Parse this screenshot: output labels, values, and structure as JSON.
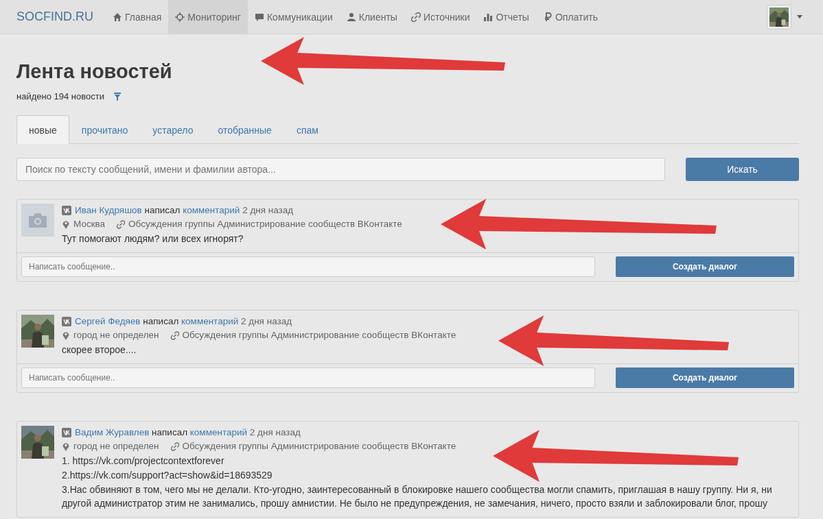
{
  "navbar": {
    "brand": "SOCFIND.RU",
    "items": [
      {
        "label": "Главная",
        "selected": false
      },
      {
        "label": "Мониторинг",
        "selected": true
      },
      {
        "label": "Коммуникации",
        "selected": false
      },
      {
        "label": "Клиенты",
        "selected": false
      },
      {
        "label": "Источники",
        "selected": false
      },
      {
        "label": "Отчеты",
        "selected": false
      },
      {
        "label": "Оплатить",
        "selected": false
      }
    ],
    "user_avatar": {
      "kind": "picture"
    }
  },
  "page": {
    "title": "Лента новостей",
    "found": "найдено 194 новости"
  },
  "tabs": [
    {
      "label": "новые",
      "selected": true
    },
    {
      "label": "прочитано",
      "selected": false
    },
    {
      "label": "устарело",
      "selected": false
    },
    {
      "label": "отобранные",
      "selected": false
    },
    {
      "label": "спам",
      "selected": false
    }
  ],
  "search": {
    "placeholder": "Поиск по тексту сообщений, имени и фамилии автора...",
    "button": "Искать"
  },
  "posts": [
    {
      "avatar": {
        "kind": "placeholder"
      },
      "author": "Иван Кудряшов",
      "action": "написал",
      "link": "комментарий",
      "time": "2 дня назад",
      "location": "Москва",
      "source": "Обсуждения группы Администрирование сообществ ВКонтакте",
      "lines": [
        "Тут помогают людям? или всех игнорят?"
      ],
      "reply_placeholder": "Написать сообщение..",
      "reply_button": "Создать диалог"
    },
    {
      "avatar": {
        "kind": "picture"
      },
      "author": "Сергей Федяев",
      "action": "написал",
      "link": "комментарий",
      "time": "2 дня назад",
      "location": "город не определен",
      "source": "Обсуждения группы Администрирование сообществ ВКонтакте",
      "lines": [
        "скорее второе...."
      ],
      "reply_placeholder": "Написать сообщение..",
      "reply_button": "Создать диалог"
    },
    {
      "avatar": {
        "kind": "picture"
      },
      "author": "Вадим Журавлев",
      "action": "написал",
      "link": "комментарий",
      "time": "2 дня назад",
      "location": "город не определен",
      "source": "Обсуждения группы Администрирование сообществ ВКонтакте",
      "lines": [
        "1. https://vk.com/projectcontextforever",
        "2.https://vk.com/support?act=show&id=18693529",
        "3.Нас обвиняют в том, чего мы не делали. Кто-угодно, заинтересованный в блокировке нашего сообщества могли спамить, приглашая в нашу группу. Ни я, ни другой администратор этим не занимались, прошу амнистии. Не было не предупреждения, не замечания, ничего, просто взяли и заблокировали блог, прошу"
      ]
    }
  ],
  "annotations": [
    {
      "kind": "arrow"
    },
    {
      "kind": "arrow"
    },
    {
      "kind": "arrow"
    },
    {
      "kind": "arrow"
    }
  ]
}
